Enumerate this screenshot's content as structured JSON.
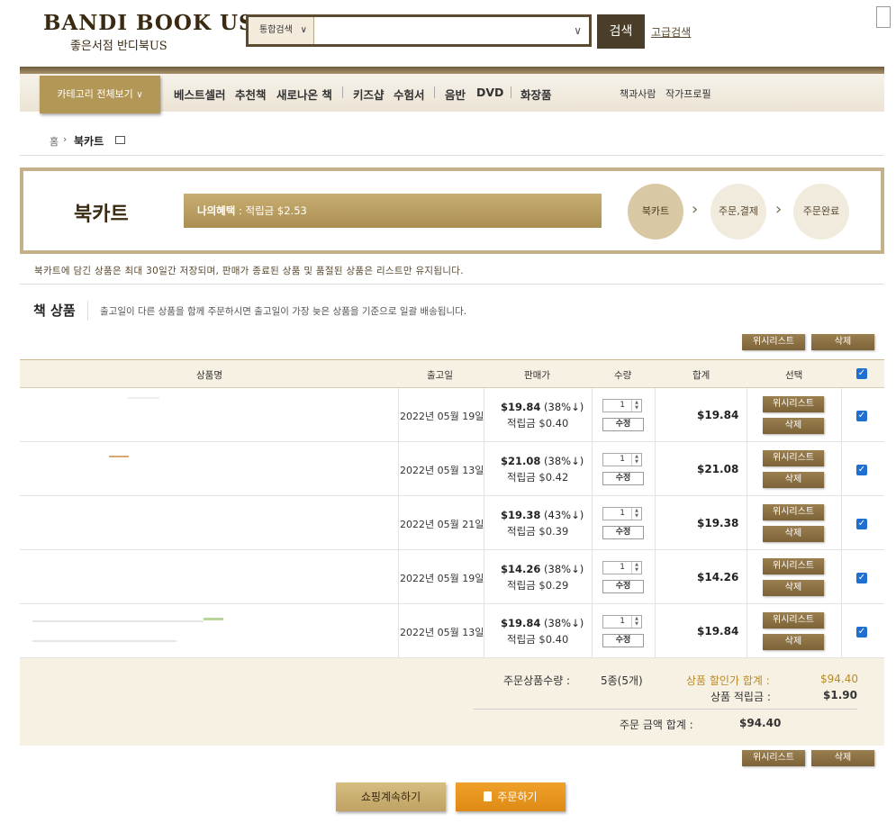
{
  "header": {
    "logo_en": "BANDI BOOK US",
    "logo_ko": "좋은서점 반디북US",
    "search_type": "통합검색",
    "search_value": "",
    "search_button": "검색",
    "advanced_search": "고급검색"
  },
  "nav": {
    "category_all": "카테고리 전체보기",
    "items": [
      "베스트셀러",
      "추천책",
      "새로나온 책",
      "키즈샵",
      "수험서",
      "음반",
      "DVD",
      "화장품"
    ],
    "right_items": [
      "책과사람",
      "작가프로필"
    ]
  },
  "breadcrumb": {
    "home": "홈",
    "current": "북카트"
  },
  "banner": {
    "title": "북카트",
    "benefit_label": "나의혜택",
    "benefit_value": ": 적립금 $2.53",
    "steps": [
      "북카트",
      "주문,결제",
      "주문완료"
    ]
  },
  "notice": "북카트에 담긴 상품은 최대 30일간 저장되며, 판매가 종료된 상품 및 품절된 상품은 리스트만 유지됩니다.",
  "section": {
    "title": "책 상품",
    "desc": "출고일이 다른 상품을 함께 주문하시면 출고일이 가장 늦은 상품을 기준으로 일괄 배송됩니다."
  },
  "actions": {
    "wishlist": "위시리스트",
    "delete": "삭제"
  },
  "table": {
    "headers": [
      "상품명",
      "출고일",
      "판매가",
      "수량",
      "합계",
      "선택"
    ],
    "rows": [
      {
        "date": "2022년 05월 19일",
        "price": "$19.84",
        "discount": "(38%↓)",
        "points": "적립금 $0.40",
        "qty": "1",
        "update": "수정",
        "total": "$19.84",
        "checked": true
      },
      {
        "date": "2022년 05월 13일",
        "price": "$21.08",
        "discount": "(38%↓)",
        "points": "적립금 $0.42",
        "qty": "1",
        "update": "수정",
        "total": "$21.08",
        "checked": true
      },
      {
        "date": "2022년 05월 21일",
        "price": "$19.38",
        "discount": "(43%↓)",
        "points": "적립금 $0.39",
        "qty": "1",
        "update": "수정",
        "total": "$19.38",
        "checked": true
      },
      {
        "date": "2022년 05월 19일",
        "price": "$14.26",
        "discount": "(38%↓)",
        "points": "적립금 $0.29",
        "qty": "1",
        "update": "수정",
        "total": "$14.26",
        "checked": true
      },
      {
        "date": "2022년 05월 13일",
        "price": "$19.84",
        "discount": "(38%↓)",
        "points": "적립금 $0.40",
        "qty": "1",
        "update": "수정",
        "total": "$19.84",
        "checked": true
      }
    ]
  },
  "summary": {
    "count_label": "주문상품수량 :",
    "count_value": "5종(5개)",
    "discount_label": "상품 할인가 합계 :",
    "discount_value": "$94.40",
    "points_label": "상품 적립금 :",
    "points_value": "$1.90",
    "total_label": "주문 금액 합계 :",
    "total_value": "$94.40"
  },
  "bottom": {
    "continue": "쇼핑계속하기",
    "order": "주문하기"
  },
  "colors": {
    "brand_brown": "#4a3d2a",
    "gold": "#b39757",
    "order_orange": "#e3901b",
    "checkbox_blue": "#1f6fd0"
  }
}
